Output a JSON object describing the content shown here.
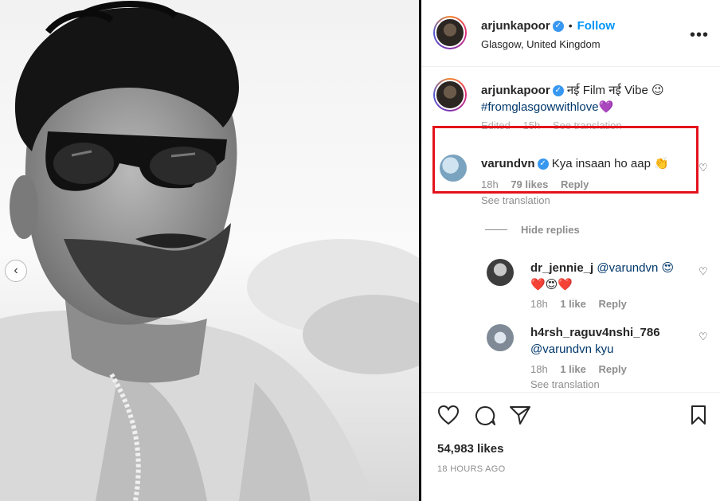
{
  "post": {
    "author": "arjunkapoor",
    "follow_label": "Follow",
    "location": "Glasgow, United Kingdom",
    "more_icon": "more-options-icon"
  },
  "caption": {
    "username": "arjunkapoor",
    "text": "नई Film नई Vibe 😉",
    "hashtag": "#fromglasgowwithlove",
    "hashtag_emoji": "💜",
    "meta_edited": "Edited",
    "meta_time": "15h",
    "meta_translation": "See translation"
  },
  "comments": [
    {
      "username": "varundvn",
      "text": "Kya insaan ho aap 👏",
      "time": "18h",
      "likes": "79 likes",
      "reply": "Reply",
      "see_translation": "See translation"
    }
  ],
  "hide_replies": "Hide replies",
  "replies": [
    {
      "username": "dr_jennie_j",
      "text": "@varundvn 😍",
      "text_line2": "❤️😍❤️",
      "time": "18h",
      "likes": "1 like",
      "reply": "Reply"
    },
    {
      "username": "h4rsh_raguv4nshi_786",
      "text": "@varundvn kyu",
      "time": "18h",
      "likes": "1 like",
      "reply": "Reply",
      "see_translation": "See translation"
    }
  ],
  "actions": {
    "like_icon": "heart-icon",
    "comment_icon": "comment-icon",
    "share_icon": "share-icon",
    "save_icon": "bookmark-icon"
  },
  "likes_count": "54,983 likes",
  "posted_ago": "18 HOURS AGO",
  "colors": {
    "follow": "#0095f6",
    "highlight": "#e3131b",
    "verified": "#3897f0"
  }
}
